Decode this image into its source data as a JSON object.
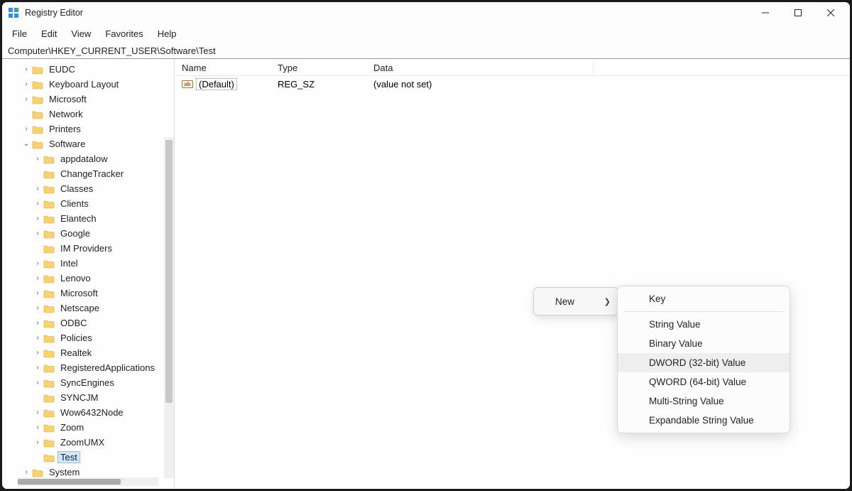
{
  "window": {
    "title": "Registry Editor"
  },
  "menu": {
    "file": "File",
    "edit": "Edit",
    "view": "View",
    "favorites": "Favorites",
    "help": "Help"
  },
  "address": "Computer\\HKEY_CURRENT_USER\\Software\\Test",
  "tree": {
    "items": [
      {
        "label": "EUDC",
        "depth": 2,
        "exp": "›"
      },
      {
        "label": "Keyboard Layout",
        "depth": 2,
        "exp": "›"
      },
      {
        "label": "Microsoft",
        "depth": 2,
        "exp": "›"
      },
      {
        "label": "Network",
        "depth": 2,
        "exp": ""
      },
      {
        "label": "Printers",
        "depth": 2,
        "exp": "›"
      },
      {
        "label": "Software",
        "depth": 2,
        "exp": "⌄"
      },
      {
        "label": "appdatalow",
        "depth": 3,
        "exp": "›"
      },
      {
        "label": "ChangeTracker",
        "depth": 3,
        "exp": ""
      },
      {
        "label": "Classes",
        "depth": 3,
        "exp": "›"
      },
      {
        "label": "Clients",
        "depth": 3,
        "exp": "›"
      },
      {
        "label": "Elantech",
        "depth": 3,
        "exp": "›"
      },
      {
        "label": "Google",
        "depth": 3,
        "exp": "›"
      },
      {
        "label": "IM Providers",
        "depth": 3,
        "exp": ""
      },
      {
        "label": "Intel",
        "depth": 3,
        "exp": "›"
      },
      {
        "label": "Lenovo",
        "depth": 3,
        "exp": "›"
      },
      {
        "label": "Microsoft",
        "depth": 3,
        "exp": "›"
      },
      {
        "label": "Netscape",
        "depth": 3,
        "exp": "›"
      },
      {
        "label": "ODBC",
        "depth": 3,
        "exp": "›"
      },
      {
        "label": "Policies",
        "depth": 3,
        "exp": "›"
      },
      {
        "label": "Realtek",
        "depth": 3,
        "exp": "›"
      },
      {
        "label": "RegisteredApplications",
        "depth": 3,
        "exp": "›"
      },
      {
        "label": "SyncEngines",
        "depth": 3,
        "exp": "›"
      },
      {
        "label": "SYNCJM",
        "depth": 3,
        "exp": ""
      },
      {
        "label": "Wow6432Node",
        "depth": 3,
        "exp": "›"
      },
      {
        "label": "Zoom",
        "depth": 3,
        "exp": "›"
      },
      {
        "label": "ZoomUMX",
        "depth": 3,
        "exp": "›"
      },
      {
        "label": "Test",
        "depth": 3,
        "exp": "",
        "selected": true
      },
      {
        "label": "System",
        "depth": 2,
        "exp": "›"
      }
    ]
  },
  "list": {
    "headers": {
      "name": "Name",
      "type": "Type",
      "data": "Data"
    },
    "rows": [
      {
        "name": "(Default)",
        "type": "REG_SZ",
        "data": "(value not set)"
      }
    ]
  },
  "context": {
    "parent": {
      "new": "New"
    },
    "sub": {
      "key": "Key",
      "string": "String Value",
      "binary": "Binary Value",
      "dword": "DWORD (32-bit) Value",
      "qword": "QWORD (64-bit) Value",
      "multistring": "Multi-String Value",
      "expandstring": "Expandable String Value"
    }
  }
}
